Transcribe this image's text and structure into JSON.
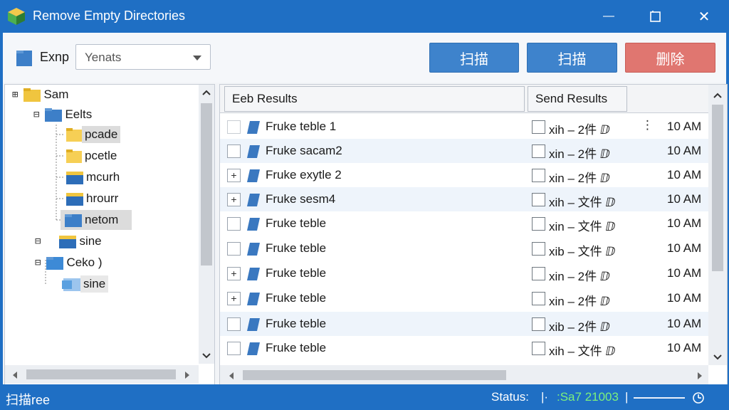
{
  "window": {
    "title": "Remove Empty Directories",
    "min_glyph": "—",
    "close_glyph": "✕"
  },
  "toolbar": {
    "path_label": "Exnp",
    "path_value": "Yenats",
    "scan_label_1": "扫描",
    "scan_label_2": "扫描",
    "delete_label": "删除"
  },
  "tree": {
    "items": [
      {
        "label": "Sam",
        "expander": "⊞"
      },
      {
        "label": "Eelts",
        "expander": "⊟"
      },
      {
        "label": "pcade"
      },
      {
        "label": "pcetle"
      },
      {
        "label": "mcurh"
      },
      {
        "label": "hrourr"
      },
      {
        "label": "netom"
      },
      {
        "label": "sine",
        "expander": "⊟"
      },
      {
        "label": "Ceko )",
        "expander": "⊟"
      },
      {
        "label": "sine"
      }
    ]
  },
  "list": {
    "col1": "Eeb Results",
    "col2": "Send Results",
    "rows": [
      {
        "check": "",
        "name": "Fruke teble 1",
        "send": "xih – 2件 ⅅ",
        "time": "10 AM",
        "dots": "⋮"
      },
      {
        "check": "",
        "name": "Fruke sacam2",
        "send": "xin – 2件 ⅅ",
        "time": "10 AM"
      },
      {
        "check": "+",
        "name": "Fruke exytle 2",
        "send": "xin – 2件 ⅅ",
        "time": "10 AM"
      },
      {
        "check": "+",
        "name": "Fruke sesm4",
        "send": "xih – 文件 ⅅ",
        "time": "10 AM"
      },
      {
        "check": "",
        "name": "Fruke teble",
        "send": "xin – 文件 ⅅ",
        "time": "10 AM"
      },
      {
        "check": "",
        "name": "Fruke teble",
        "send": "xib – 文件 ⅅ",
        "time": "10 AM"
      },
      {
        "check": "+",
        "name": "Fruke teble",
        "send": "xin – 2件 ⅅ",
        "time": "10 AM"
      },
      {
        "check": "+",
        "name": "Fruke teble",
        "send": "xin – 2件 ⅅ",
        "time": "10 AM"
      },
      {
        "check": "",
        "name": "Fruke teble",
        "send": "xib – 2件 ⅅ",
        "time": "10 AM"
      },
      {
        "check": "",
        "name": "Fruke teble",
        "send": "xih – 文件 ⅅ",
        "time": "10 AM"
      }
    ]
  },
  "status": {
    "left": "扫描ree",
    "label": "Status:",
    "sep": "|·",
    "value": ":Sa7 21003",
    "sep2": "|"
  },
  "colors": {
    "title_bar": "#1f6fc4",
    "scan_button": "#3e83cc",
    "delete_button": "#e07670",
    "status_value": "#7cf07c"
  }
}
